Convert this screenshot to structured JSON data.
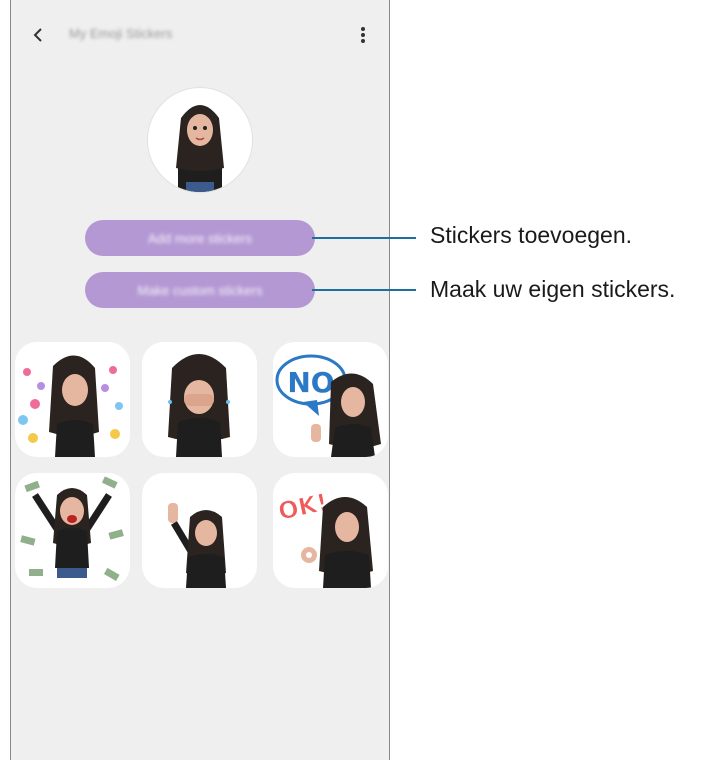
{
  "header": {
    "title": "My Emoji Stickers"
  },
  "buttons": {
    "add_more": "Add more stickers",
    "make_custom": "Make custom stickers"
  },
  "stickers": [
    {
      "name": "hearts"
    },
    {
      "name": "shy-hands"
    },
    {
      "name": "no"
    },
    {
      "name": "money-rain"
    },
    {
      "name": "wave"
    },
    {
      "name": "ok"
    }
  ],
  "sticker_text": {
    "no": "NO",
    "ok": "OK!"
  },
  "callouts": {
    "add_stickers": "Stickers toevoegen.",
    "make_own": "Maak uw eigen stickers."
  },
  "colors": {
    "accent": "#b498d4",
    "leader_line": "#1f6f9c",
    "background": "#efefef"
  }
}
